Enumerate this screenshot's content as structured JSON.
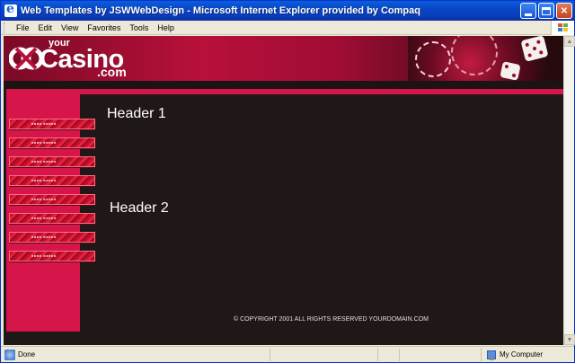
{
  "window": {
    "title": "Web Templates by JSWWebDesign - Microsoft Internet Explorer provided by Compaq"
  },
  "menu": {
    "items": [
      "File",
      "Edit",
      "View",
      "Favorites",
      "Tools",
      "Help"
    ]
  },
  "site": {
    "logo_your": "your",
    "logo_casino": "Casino",
    "logo_com": ".com",
    "header1": "Header 1",
    "header2": "Header 2",
    "copyright": "© COPYRIGHT 2001 ALL RIGHTS RESERVED YOURDOMAIN.COM",
    "nav_buttons": 8,
    "colors": {
      "accent": "#d6154a",
      "content_bg": "#201717"
    }
  },
  "status": {
    "text": "Done",
    "zone": "My Computer"
  }
}
